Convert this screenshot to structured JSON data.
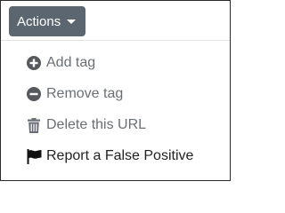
{
  "dropdown": {
    "toggle_label": "Actions",
    "items": [
      {
        "icon": "plus-circle-icon",
        "label": "Add tag"
      },
      {
        "icon": "minus-circle-icon",
        "label": "Remove tag"
      },
      {
        "icon": "trash-icon",
        "label": "Delete this URL"
      },
      {
        "icon": "flag-icon",
        "label": "Report a False Positive"
      }
    ]
  },
  "colors": {
    "button_bg": "#5b6670",
    "button_text": "#ffffff",
    "muted_item": "#6a6f75",
    "report_item": "#222222"
  }
}
